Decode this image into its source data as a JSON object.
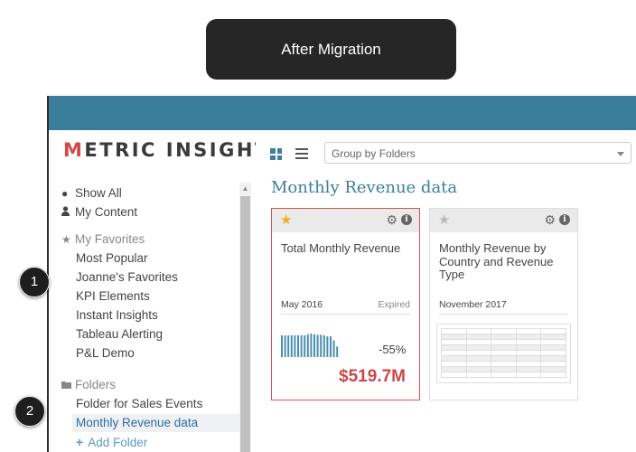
{
  "banner": {
    "label": "After Migration"
  },
  "app": {
    "logo": {
      "part1": "M",
      "part2": "ETRIC INSIGHTS"
    },
    "sidebar": {
      "show_all": "Show All",
      "my_content": "My Content",
      "favorites_header": "My Favorites",
      "favorites": [
        "Most Popular",
        "Joanne's Favorites",
        "KPI Elements",
        "Instant Insights",
        "Tableau Alerting",
        "P&L Demo"
      ],
      "folders_header": "Folders",
      "folders": [
        "Folder for Sales Events",
        "Monthly Revenue data"
      ],
      "add_folder": "Add Folder"
    },
    "toolbar": {
      "group_by": "Group by Folders"
    },
    "page_title": "Monthly Revenue data",
    "cards": [
      {
        "title": "Total Monthly Revenue",
        "date": "May 2016",
        "status": "Expired",
        "change": "-55%",
        "value": "$519.7M",
        "favorited": true,
        "sparkline": [
          0.86,
          0.86,
          0.86,
          0.86,
          0.86,
          0.86,
          0.86,
          0.86,
          0.9,
          0.93,
          0.9,
          0.88,
          0.88,
          0.86,
          0.82,
          0.82,
          0.66,
          0.42
        ]
      },
      {
        "title": "Monthly Revenue by Country and Revenue Type",
        "date": "November 2017",
        "favorited": false
      }
    ]
  },
  "steps": [
    "1",
    "2"
  ],
  "colors": {
    "topbar": "#3b7e9b",
    "title": "#3b7e9b",
    "value": "#c9484b",
    "star_active": "#f0ad1e",
    "star_inactive": "#bbbbbb",
    "selected_border": "#d9534f"
  }
}
